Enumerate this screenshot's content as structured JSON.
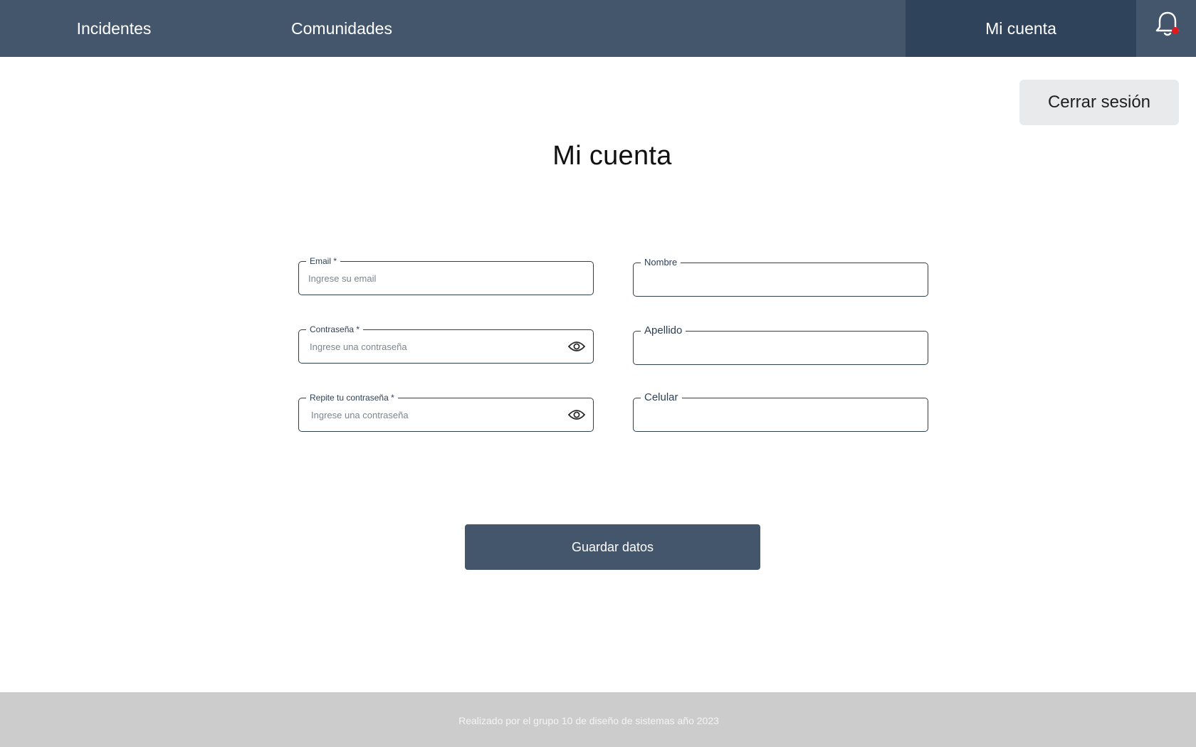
{
  "nav": {
    "items": [
      {
        "label": "Incidentes"
      },
      {
        "label": "Comunidades"
      },
      {
        "label": "Mi cuenta",
        "active": true
      }
    ],
    "bell_icon": "bell-icon",
    "notification_dot_color": "#e0191e",
    "bar_color": "#44566c",
    "active_color": "#2f435b"
  },
  "header": {
    "logout_label": "Cerrar sesión"
  },
  "page": {
    "title": "Mi cuenta"
  },
  "form": {
    "email": {
      "label": "Email *",
      "placeholder": "Ingrese su email",
      "value": ""
    },
    "password": {
      "label": "Contraseña *",
      "placeholder": "Ingrese una contraseña",
      "value": "",
      "toggle_icon": "eye-icon"
    },
    "password_repeat": {
      "label": "Repite tu contraseña *",
      "placeholder": "Ingrese una contraseña",
      "value": "",
      "toggle_icon": "eye-icon"
    },
    "nombre": {
      "label": "Nombre",
      "value": ""
    },
    "apellido": {
      "label": "Apellido",
      "value": ""
    },
    "celular": {
      "label": "Celular",
      "value": ""
    },
    "save_label": "Guardar datos",
    "save_color": "#44566c"
  },
  "footer": {
    "text": "Realizado por el grupo 10 de diseño de sistemas año 2023"
  }
}
